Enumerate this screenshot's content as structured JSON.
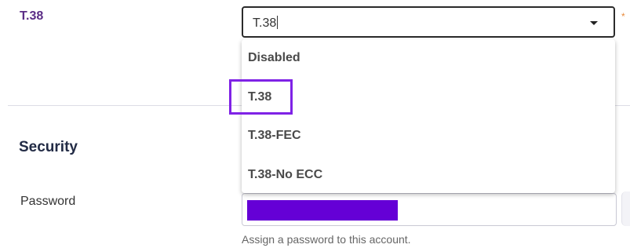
{
  "fax": {
    "label": "T.38",
    "select_value": "T.38",
    "required_marker": "*",
    "options": [
      "Disabled",
      "T.38",
      "T.38-FEC",
      "T.38-No ECC"
    ],
    "highlighted_option": "T.38",
    "highlight_color": "#7f22e6"
  },
  "security": {
    "title": "Security",
    "password_label": "Password",
    "password_hint": "Assign a password to this account.",
    "redaction_color": "#6500d6"
  },
  "colors": {
    "label_purple": "#5b2d86",
    "required_orange": "#e8893a"
  }
}
